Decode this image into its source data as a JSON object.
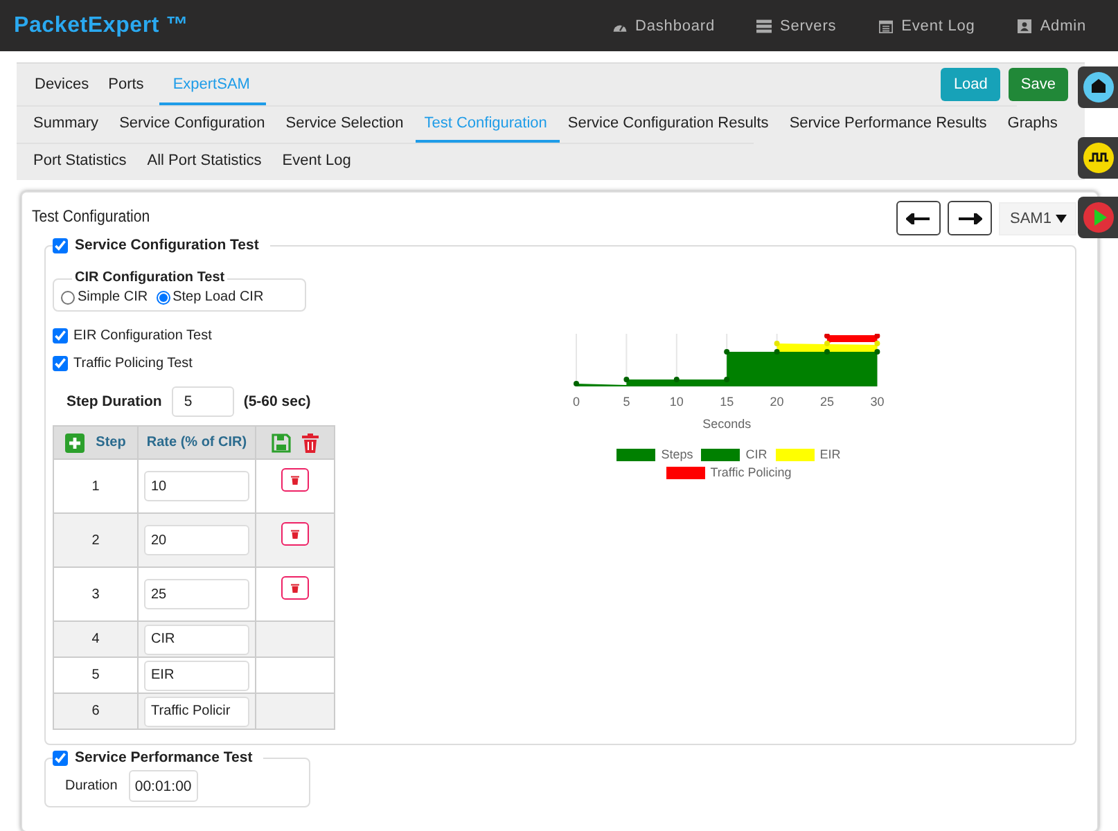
{
  "app": {
    "title": "PacketExpert ™",
    "nav": [
      {
        "label": "Dashboard"
      },
      {
        "label": "Servers"
      },
      {
        "label": "Event Log"
      },
      {
        "label": "Admin"
      }
    ]
  },
  "top_tabs": [
    {
      "label": "Devices",
      "selected": false
    },
    {
      "label": "Ports",
      "selected": false
    },
    {
      "label": "ExpertSAM",
      "selected": true
    }
  ],
  "actions": [
    {
      "label": "Load",
      "kind": "info"
    },
    {
      "label": "Save",
      "kind": "success"
    }
  ],
  "sub_tabs": [
    [
      {
        "label": "Summary",
        "selected": false
      },
      {
        "label": "Service Configuration",
        "selected": false
      },
      {
        "label": "Service Selection",
        "selected": false
      },
      {
        "label": "Test Configuration",
        "selected": true
      },
      {
        "label": "Service Configuration Results",
        "selected": false
      },
      {
        "label": "Service Performance Results",
        "selected": false
      },
      {
        "label": "Graphs",
        "selected": false
      }
    ],
    [
      {
        "label": "Port Statistics",
        "selected": false
      },
      {
        "label": "All Port Statistics",
        "selected": false
      },
      {
        "label": "Event Log",
        "selected": false
      }
    ]
  ],
  "card": {
    "title": "Test Configuration",
    "selector": "SAM1"
  },
  "service_config": {
    "label": "Service Configuration Test",
    "checked": true,
    "cir": {
      "legend": "CIR Configuration Test",
      "options": [
        {
          "label": "Simple CIR",
          "selected": false
        },
        {
          "label": "Step Load CIR",
          "selected": true
        }
      ]
    },
    "checks": [
      {
        "label": "EIR Configuration Test",
        "checked": true
      },
      {
        "label": "Traffic Policing Test",
        "checked": true
      }
    ],
    "step_duration": {
      "label": "Step Duration",
      "value": "5",
      "hint": "(5-60 sec)"
    },
    "table": {
      "columns": [
        "Step",
        "Rate (% of CIR)"
      ],
      "rows": [
        {
          "step": "1",
          "rate": "10",
          "deletable": true
        },
        {
          "step": "2",
          "rate": "20",
          "deletable": true
        },
        {
          "step": "3",
          "rate": "25",
          "deletable": true
        },
        {
          "step": "4",
          "rate": "CIR",
          "deletable": false
        },
        {
          "step": "5",
          "rate": "EIR",
          "deletable": false
        },
        {
          "step": "6",
          "rate": "Traffic Policir",
          "deletable": false
        }
      ]
    },
    "chart": {
      "xlabel": "Seconds",
      "xticks": [
        "0",
        "5",
        "10",
        "15",
        "20",
        "25",
        "30"
      ],
      "legend": [
        {
          "label": "Steps",
          "color": "#008000"
        },
        {
          "label": "CIR",
          "color": "#008000"
        },
        {
          "label": "EIR",
          "color": "#ffff00"
        },
        {
          "label": "Traffic Policing",
          "color": "#ff0000"
        }
      ]
    }
  },
  "service_perf": {
    "label": "Service Performance Test",
    "checked": true,
    "duration_label": "Duration",
    "duration": "00:01:00"
  }
}
